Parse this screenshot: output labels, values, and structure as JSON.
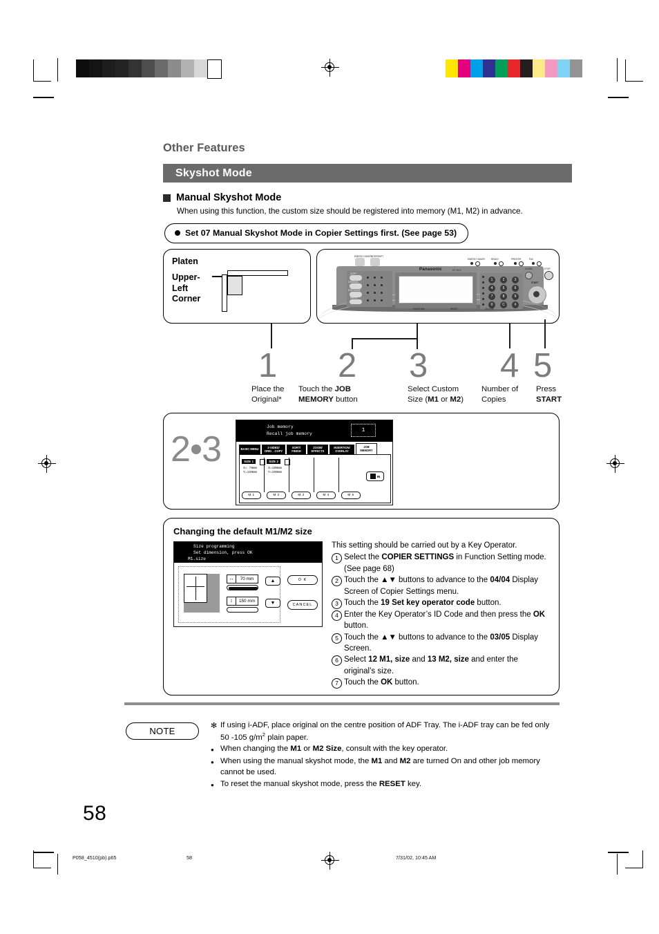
{
  "page": {
    "section_title": "Other Features",
    "banner": "Skyshot Mode",
    "subheading": "Manual Skyshot Mode",
    "intro": "When using this function, the custom size should be registered into memory (M1, M2) in advance.",
    "callout": "Set 07 Manual Skyshot Mode in Copier Settings first. (See page 53)",
    "page_number": "58"
  },
  "platen": {
    "title": "Platen",
    "corner_label_line1": "Upper-",
    "corner_label_line2": "Left",
    "corner_label_line3": "Corner"
  },
  "panel": {
    "brand": "Panasonic",
    "brand_sub": "DP-4510",
    "labels": {
      "clear": "CLEAR",
      "stop": "STOP",
      "start": "START",
      "copy": "COPY",
      "original": "ORIGINAL",
      "exposure": "EXPOSURE",
      "paper": "PAPER",
      "energy_saver": "ENERGY SAVER",
      "interrupt": "INTERRUPT",
      "function": "FUNCTION",
      "reset": "RESET",
      "online": "ON LINE",
      "printer": "PRINTER",
      "ready": "READY",
      "data": "DATA",
      "fax": "FAX"
    },
    "keypad": [
      "1",
      "2",
      "3",
      "4",
      "5",
      "6",
      "7",
      "8",
      "9",
      "0",
      "C",
      "#"
    ]
  },
  "steps": [
    {
      "num": "1",
      "line1": "Place the",
      "line2": "Original*",
      "bold2": ""
    },
    {
      "num": "2",
      "line1": "Touch the ",
      "bold1": "JOB",
      "line2_bold": "MEMORY",
      "line2": " button"
    },
    {
      "num": "3",
      "line1": "Select Custom",
      "line2_pre": "Size (",
      "m1": "M1",
      "or": " or ",
      "m2": "M2",
      "line2_post": ")"
    },
    {
      "num": "4",
      "line1": "Number of",
      "line2": "Copies"
    },
    {
      "num": "5",
      "line1": "Press",
      "line2_bold": "START"
    }
  ],
  "job_memory_figure": {
    "step_label": "2•3",
    "lcd_title_line1": "Job memory",
    "lcd_title_line2": "Recall job memory",
    "counter": "1",
    "tabs": [
      {
        "l1": "BASIC MENU",
        "l2": "",
        "selected": false
      },
      {
        "l1": "2-SIDED/",
        "l2": "ORIG→COPY",
        "selected": false
      },
      {
        "l1": "SORT/",
        "l2": "FINISH",
        "selected": false
      },
      {
        "l1": "ZOOM/",
        "l2": "EFFECTS",
        "selected": false
      },
      {
        "l1": "INSERTION/",
        "l2": "OVERLAY",
        "selected": false
      },
      {
        "l1": "JOB",
        "l2": "MEMORY",
        "selected": true
      }
    ],
    "cells": [
      {
        "chip": "SIZE 1",
        "x": "X= 70mm",
        "y": "Y=150mm",
        "button": "M 1"
      },
      {
        "chip": "SIZE 2",
        "x": "X=100mm",
        "y": "Y=200mm",
        "button": "M 2"
      },
      {
        "chip": "",
        "x": "",
        "y": "",
        "button": "M 3"
      },
      {
        "chip": "",
        "x": "",
        "y": "",
        "button": "M 4"
      },
      {
        "chip": "",
        "x": "",
        "y": "",
        "button": "M 5"
      }
    ],
    "in_button": "IN"
  },
  "default_size": {
    "title": "Changing the default M1/M2 size",
    "screen": {
      "line1": "Size programming",
      "line2": "Set dimension, press OK",
      "line3": "M1.size",
      "width_value": "70 mm",
      "height_value": "150 mm",
      "ok": "O K",
      "cancel": "CANCEL"
    },
    "lead_in": "This setting should be carried out by a Key Operator.",
    "items": [
      {
        "n": "1",
        "parts": [
          {
            "t": "Select the ",
            "b": false
          },
          {
            "t": "COPIER SETTINGS",
            "b": true
          },
          {
            "t": " in Function Setting mode.",
            "b": false
          },
          {
            "t": "\n(See page 68)",
            "b": false
          }
        ]
      },
      {
        "n": "2",
        "parts": [
          {
            "t": "Touch the ▲▼ buttons to advance to the ",
            "b": false
          },
          {
            "t": "04/04",
            "b": true
          },
          {
            "t": " Display Screen of Copier Settings menu.",
            "b": false
          }
        ]
      },
      {
        "n": "3",
        "parts": [
          {
            "t": "Touch the ",
            "b": false
          },
          {
            "t": "19 Set key operator code",
            "b": true
          },
          {
            "t": " button.",
            "b": false
          }
        ]
      },
      {
        "n": "4",
        "parts": [
          {
            "t": "Enter the Key Operator’s ID Code and then press the ",
            "b": false
          },
          {
            "t": "OK",
            "b": true
          },
          {
            "t": " button.",
            "b": false
          }
        ]
      },
      {
        "n": "5",
        "parts": [
          {
            "t": "Touch the ▲▼ buttons to advance to the ",
            "b": false
          },
          {
            "t": "03/05",
            "b": true
          },
          {
            "t": " Display Screen.",
            "b": false
          }
        ]
      },
      {
        "n": "6",
        "parts": [
          {
            "t": "Select ",
            "b": false
          },
          {
            "t": "12 M1, size",
            "b": true
          },
          {
            "t": " and ",
            "b": false
          },
          {
            "t": "13 M2, size",
            "b": true
          },
          {
            "t": " and enter the original’s size.",
            "b": false
          }
        ]
      },
      {
        "n": "7",
        "parts": [
          {
            "t": "Touch the ",
            "b": false
          },
          {
            "t": "OK",
            "b": true
          },
          {
            "t": " button.",
            "b": false
          }
        ]
      }
    ]
  },
  "note": {
    "label": "NOTE",
    "items": [
      {
        "mark": "✻",
        "parts": [
          {
            "t": "If using i-ADF, place original on the centre position of ADF Tray. The i-ADF tray can be fed only 50 -105 g/m",
            "b": false
          },
          {
            "t": "2",
            "sup": true
          },
          {
            "t": " plain paper.",
            "b": false
          }
        ]
      },
      {
        "mark": "●",
        "parts": [
          {
            "t": "When changing the ",
            "b": false
          },
          {
            "t": "M1",
            "b": true
          },
          {
            "t": " or ",
            "b": false
          },
          {
            "t": "M2 Size",
            "b": true
          },
          {
            "t": ", consult with the key operator.",
            "b": false
          }
        ]
      },
      {
        "mark": "●",
        "parts": [
          {
            "t": "When using the manual skyshot mode, the ",
            "b": false
          },
          {
            "t": "M1",
            "b": true
          },
          {
            "t": " and ",
            "b": false
          },
          {
            "t": "M2",
            "b": true
          },
          {
            "t": " are turned On and other job memory cannot be used.",
            "b": false
          }
        ]
      },
      {
        "mark": "●",
        "parts": [
          {
            "t": "To reset the manual skyshot mode, press the ",
            "b": false
          },
          {
            "t": "RESET",
            "b": true
          },
          {
            "t": " key.",
            "b": false
          }
        ]
      }
    ]
  },
  "footer": {
    "filename": "P058_4510(pb).p65",
    "page": "58",
    "timestamp": "7/31/02, 10:45 AM"
  },
  "print_marks": {
    "gray_steps": [
      "#0d0d0d",
      "#141414",
      "#1d1d1d",
      "#242424",
      "#333333",
      "#4d4d4d",
      "#6b6b6b",
      "#8c8c8c",
      "#b2b2b2",
      "#d8d8d8",
      "#ffffff"
    ],
    "color_patches": [
      "#ffe500",
      "#e5007e",
      "#00a0e9",
      "#2e3192",
      "#00a05a",
      "#e8262b",
      "#231f20",
      "#fbe98a",
      "#f49ac1",
      "#7fd4f5",
      "#949494"
    ]
  }
}
